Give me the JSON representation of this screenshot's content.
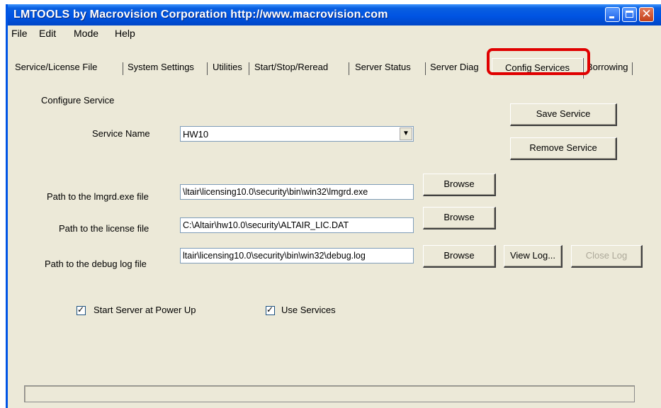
{
  "window": {
    "title": "LMTOOLS by Macrovision Corporation http://www.macrovision.com",
    "controls": [
      "minimize",
      "maximize",
      "close"
    ]
  },
  "menu": [
    "File",
    "Edit",
    "Mode",
    "Help"
  ],
  "tabs": [
    "Service/License File",
    "System Settings",
    "Utilities",
    "Start/Stop/Reread",
    "Server Status",
    "Server Diag",
    "Config Services",
    "Borrowing"
  ],
  "active_tab": "Config Services",
  "config": {
    "section_title": "Configure Service",
    "service_name_label": "Service Name",
    "service_name_value": "HW10",
    "save_service": "Save Service",
    "remove_service": "Remove Service",
    "lmgrd_label": "Path to the lmgrd.exe file",
    "lmgrd_value": "\\ltair\\licensing10.0\\security\\bin\\win32\\lmgrd.exe",
    "license_label": "Path to the license file",
    "license_value": "C:\\Altair\\hw10.0\\security\\ALTAIR_LIC.DAT",
    "debug_label": "Path to the debug log file",
    "debug_value": "ltair\\licensing10.0\\security\\bin\\win32\\debug.log",
    "browse": "Browse",
    "view_log": "View Log...",
    "close_log": "Close Log",
    "start_at_powerup": "Start Server at Power Up",
    "start_at_powerup_checked": true,
    "use_services": "Use Services",
    "use_services_checked": true
  },
  "colors": {
    "titlebar": "#0054e3",
    "window_bg": "#ece9d8",
    "highlight": "#e00000"
  }
}
